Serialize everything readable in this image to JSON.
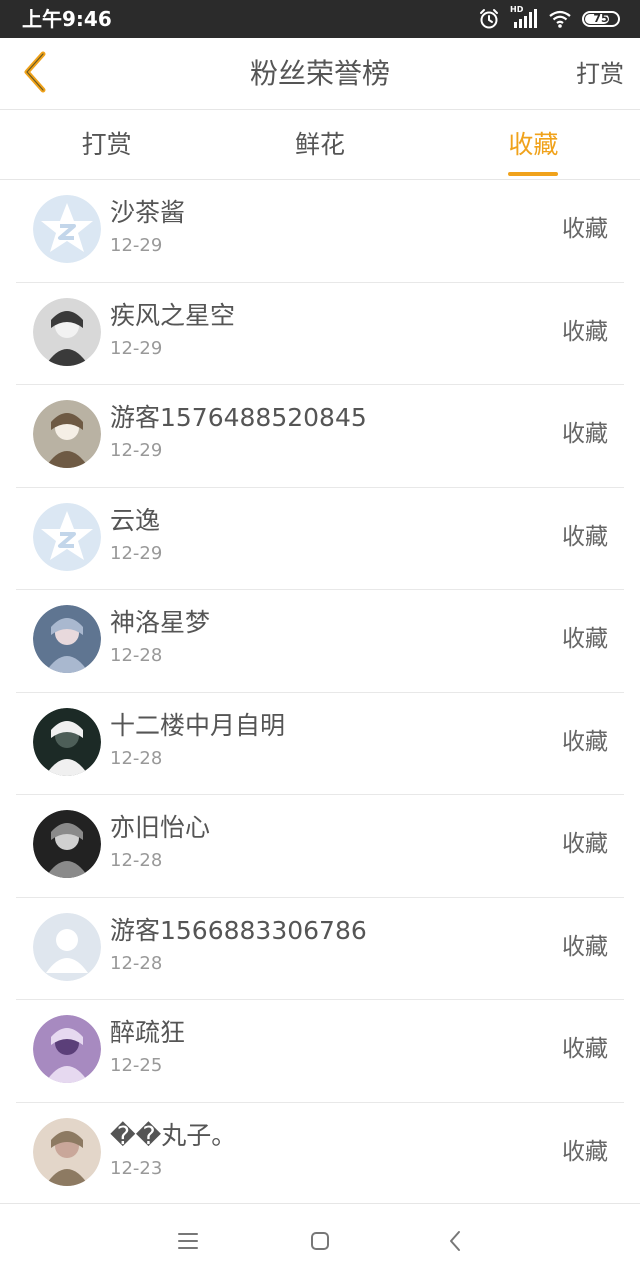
{
  "status_bar": {
    "time": "上午9:46",
    "network_label": "HD",
    "battery_level": "75",
    "battery_fraction": 0.75,
    "icons": [
      "alarm-icon",
      "signal-icon",
      "wifi-icon",
      "battery-icon"
    ]
  },
  "header": {
    "back_icon": "chevron-left-icon",
    "title": "粉丝荣誉榜",
    "action_label": "打赏"
  },
  "colors": {
    "accent": "#f0a21b",
    "text": "#555555",
    "subtext": "#999999",
    "divider": "#e8e8e8"
  },
  "tabs": [
    {
      "label": "打赏",
      "active": false
    },
    {
      "label": "鲜花",
      "active": false
    },
    {
      "label": "收藏",
      "active": true
    }
  ],
  "fans": [
    {
      "name": "沙茶酱",
      "date": "12-29",
      "type": "收藏",
      "avatar": "default-z-avatar"
    },
    {
      "name": "疾风之星空",
      "date": "12-29",
      "type": "收藏",
      "avatar": "photo-avatar"
    },
    {
      "name": "游客1576488520845",
      "date": "12-29",
      "type": "收藏",
      "avatar": "photo-avatar"
    },
    {
      "name": "云逸",
      "date": "12-29",
      "type": "收藏",
      "avatar": "default-z-avatar"
    },
    {
      "name": "神洛星梦",
      "date": "12-28",
      "type": "收藏",
      "avatar": "photo-avatar"
    },
    {
      "name": "十二楼中月自明",
      "date": "12-28",
      "type": "收藏",
      "avatar": "photo-avatar"
    },
    {
      "name": "亦旧怡心",
      "date": "12-28",
      "type": "收藏",
      "avatar": "photo-avatar"
    },
    {
      "name": "游客1566883306786",
      "date": "12-28",
      "type": "收藏",
      "avatar": "default-person-avatar"
    },
    {
      "name": "醉疏狂",
      "date": "12-25",
      "type": "收藏",
      "avatar": "photo-avatar"
    },
    {
      "name": "��丸子。",
      "date": "12-23",
      "type": "收藏",
      "avatar": "photo-avatar"
    }
  ],
  "nav_bar": {
    "icons": [
      "menu-icon",
      "home-icon",
      "back-icon"
    ]
  }
}
